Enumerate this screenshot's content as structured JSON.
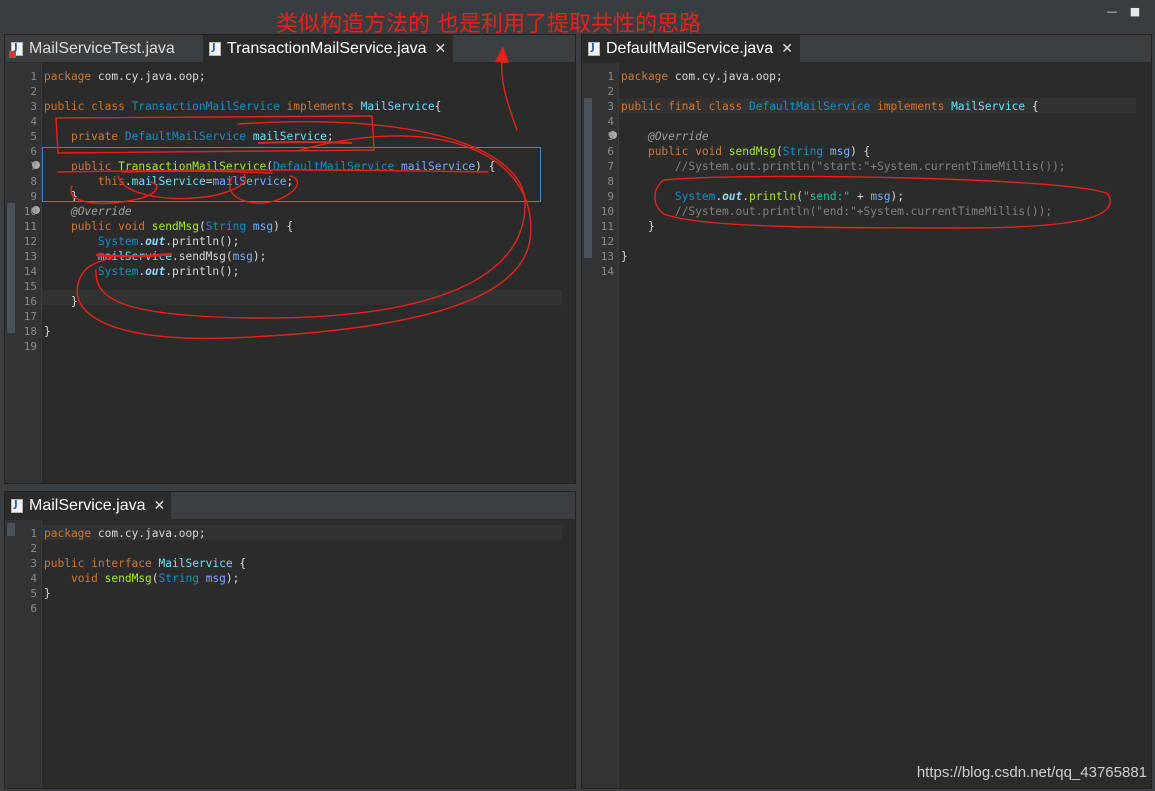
{
  "window": {
    "minimize_glyph": "—",
    "maximize_glyph": "■"
  },
  "annotation": {
    "title": "类似构造方法的 也是利用了提取共性的思路"
  },
  "watermark": "https://blog.csdn.net/qq_43765881",
  "colors": {
    "annotation_red": "#e8221a",
    "editor_bg": "#2b2b2b",
    "keyword": "#cc7832",
    "type": "#1290c3",
    "method": "#a7ec21",
    "field": "#66e1f8",
    "string": "#17c6a3"
  },
  "panes": {
    "top_left": {
      "tabs": [
        {
          "label": "MailServiceTest.java",
          "icon": "java-file-error-icon"
        },
        {
          "label": "TransactionMailService.java",
          "icon": "java-file-icon",
          "close": "✕"
        }
      ],
      "lines": [
        [
          [
            "t-kw",
            "package "
          ],
          [
            "t-pl",
            "com.cy.java.oop;"
          ]
        ],
        [],
        [
          [
            "t-kw",
            "public class "
          ],
          [
            "t-ty",
            "TransactionMailService "
          ],
          [
            "t-kw",
            "implements "
          ],
          [
            "t-fld",
            "MailService"
          ],
          [
            "t-pl",
            "{"
          ]
        ],
        [],
        [
          [
            "t-pl",
            "    "
          ],
          [
            "t-kw",
            "private "
          ],
          [
            "t-ty",
            "DefaultMailService "
          ],
          [
            "t-fld",
            "mailService"
          ],
          [
            "t-pl",
            ";"
          ]
        ],
        [],
        [
          [
            "t-pl",
            "    "
          ],
          [
            "t-kw",
            "public "
          ],
          [
            "t-fn",
            "TransactionMailService"
          ],
          [
            "t-pl",
            "("
          ],
          [
            "t-ty",
            "DefaultMailService "
          ],
          [
            "t-var",
            "mailService"
          ],
          [
            "t-pl",
            ") {"
          ]
        ],
        [
          [
            "t-pl",
            "        "
          ],
          [
            "t-kw",
            "this"
          ],
          [
            "t-pl",
            "."
          ],
          [
            "t-fld",
            "mailService"
          ],
          [
            "t-pl",
            "="
          ],
          [
            "t-var",
            "mailService"
          ],
          [
            "t-pl",
            ";"
          ]
        ],
        [
          [
            "t-pl",
            "    }"
          ]
        ],
        [
          [
            "t-pl",
            "    "
          ],
          [
            "t-ann",
            "@Override"
          ]
        ],
        [
          [
            "t-pl",
            "    "
          ],
          [
            "t-kw",
            "public void "
          ],
          [
            "t-fn",
            "sendMsg"
          ],
          [
            "t-pl",
            "("
          ],
          [
            "t-ty",
            "String "
          ],
          [
            "t-var",
            "msg"
          ],
          [
            "t-pl",
            ") {"
          ]
        ],
        [
          [
            "t-pl",
            "        "
          ],
          [
            "t-ty",
            "System"
          ],
          [
            "t-pl",
            "."
          ],
          [
            "t-sf",
            "out"
          ],
          [
            "t-pl",
            ".println();"
          ]
        ],
        [
          [
            "t-pl",
            "        "
          ],
          [
            "t-fld",
            "mailService"
          ],
          [
            "t-pl",
            ".sendMsg("
          ],
          [
            "t-var",
            "msg"
          ],
          [
            "t-pl",
            ");"
          ]
        ],
        [
          [
            "t-pl",
            "        "
          ],
          [
            "t-ty",
            "System"
          ],
          [
            "t-pl",
            "."
          ],
          [
            "t-sf",
            "out"
          ],
          [
            "t-pl",
            ".println();"
          ]
        ],
        [],
        [
          [
            "t-pl",
            "    }"
          ]
        ],
        [],
        [
          [
            "t-pl",
            "}"
          ]
        ],
        []
      ]
    },
    "bottom_left": {
      "tabs": [
        {
          "label": "MailService.java",
          "icon": "java-file-icon",
          "close": "✕"
        }
      ],
      "lines": [
        [
          [
            "t-kw",
            "package "
          ],
          [
            "t-pl",
            "com.cy.java.oop;"
          ]
        ],
        [],
        [
          [
            "t-kw",
            "public interface "
          ],
          [
            "t-fld",
            "MailService "
          ],
          [
            "t-pl",
            "{"
          ]
        ],
        [
          [
            "t-pl",
            "    "
          ],
          [
            "t-kw",
            "void "
          ],
          [
            "t-fn",
            "sendMsg"
          ],
          [
            "t-pl",
            "("
          ],
          [
            "t-ty",
            "String "
          ],
          [
            "t-var",
            "msg"
          ],
          [
            "t-pl",
            ");"
          ]
        ],
        [
          [
            "t-pl",
            "}"
          ]
        ],
        []
      ]
    },
    "right": {
      "tabs": [
        {
          "label": "DefaultMailService.java",
          "icon": "java-file-icon",
          "close": "✕"
        }
      ],
      "lines": [
        [
          [
            "t-kw",
            "package "
          ],
          [
            "t-pl",
            "com.cy.java.oop;"
          ]
        ],
        [],
        [
          [
            "t-kw",
            "public final class "
          ],
          [
            "t-ty",
            "DefaultMailService "
          ],
          [
            "t-kw",
            "implements "
          ],
          [
            "t-fld",
            "MailService "
          ],
          [
            "t-pl",
            "{"
          ]
        ],
        [],
        [
          [
            "t-pl",
            "    "
          ],
          [
            "t-ann",
            "@Override"
          ]
        ],
        [
          [
            "t-pl",
            "    "
          ],
          [
            "t-kw",
            "public void "
          ],
          [
            "t-fn",
            "sendMsg"
          ],
          [
            "t-pl",
            "("
          ],
          [
            "t-ty",
            "String "
          ],
          [
            "t-var",
            "msg"
          ],
          [
            "t-pl",
            ") {"
          ]
        ],
        [
          [
            "t-pl",
            "        "
          ],
          [
            "t-com",
            "//System.out.println(\"start:\"+System.currentTimeMillis());"
          ]
        ],
        [],
        [
          [
            "t-pl",
            "        "
          ],
          [
            "t-ty",
            "System"
          ],
          [
            "t-pl",
            "."
          ],
          [
            "t-sf",
            "out"
          ],
          [
            "t-pl",
            "."
          ],
          [
            "t-fn",
            "println"
          ],
          [
            "t-pl",
            "("
          ],
          [
            "t-str",
            "\"send:\""
          ],
          [
            "t-pl",
            " + "
          ],
          [
            "t-var",
            "msg"
          ],
          [
            "t-pl",
            ");"
          ]
        ],
        [
          [
            "t-pl",
            "        "
          ],
          [
            "t-com",
            "//System.out.println(\"end:\"+System.currentTimeMillis());"
          ]
        ],
        [
          [
            "t-pl",
            "    }"
          ]
        ],
        [],
        [
          [
            "t-pl",
            "}"
          ]
        ],
        []
      ]
    }
  }
}
